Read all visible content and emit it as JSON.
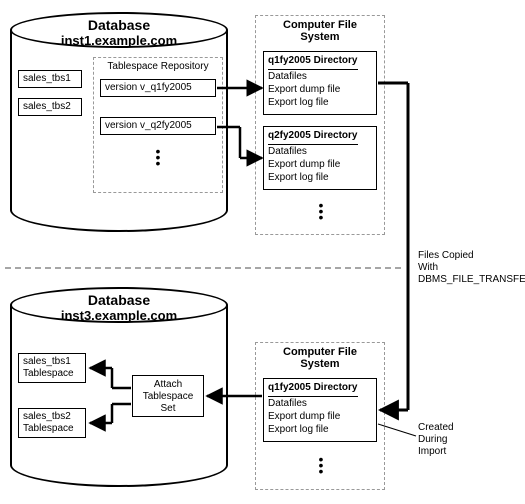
{
  "db1": {
    "title": "Database",
    "host": "inst1.example.com",
    "ts1": "sales_tbs1",
    "ts2": "sales_tbs2",
    "repo_title": "Tablespace Repository",
    "version1": "version v_q1fy2005",
    "version2": "version v_q2fy2005"
  },
  "cfs1": {
    "title": "Computer File\nSystem",
    "dir1_title": "q1fy2005 Directory",
    "dir2_title": "q2fy2005 Directory",
    "line1": "Datafiles",
    "line2": "Export dump file",
    "line3": "Export log file"
  },
  "divider_note": "Files Copied\nWith\nDBMS_FILE_TRANSFER",
  "db3": {
    "title": "Database",
    "host": "inst3.example.com",
    "ts1": "sales_tbs1\nTablespace",
    "ts2": "sales_tbs2\nTablespace",
    "attach": "Attach\nTablespace\nSet"
  },
  "cfs2": {
    "title": "Computer File\nSystem",
    "dir1_title": "q1fy2005 Directory",
    "line1": "Datafiles",
    "line2": "Export dump file",
    "line3": "Export log file",
    "note": "Created\nDuring\nImport"
  }
}
